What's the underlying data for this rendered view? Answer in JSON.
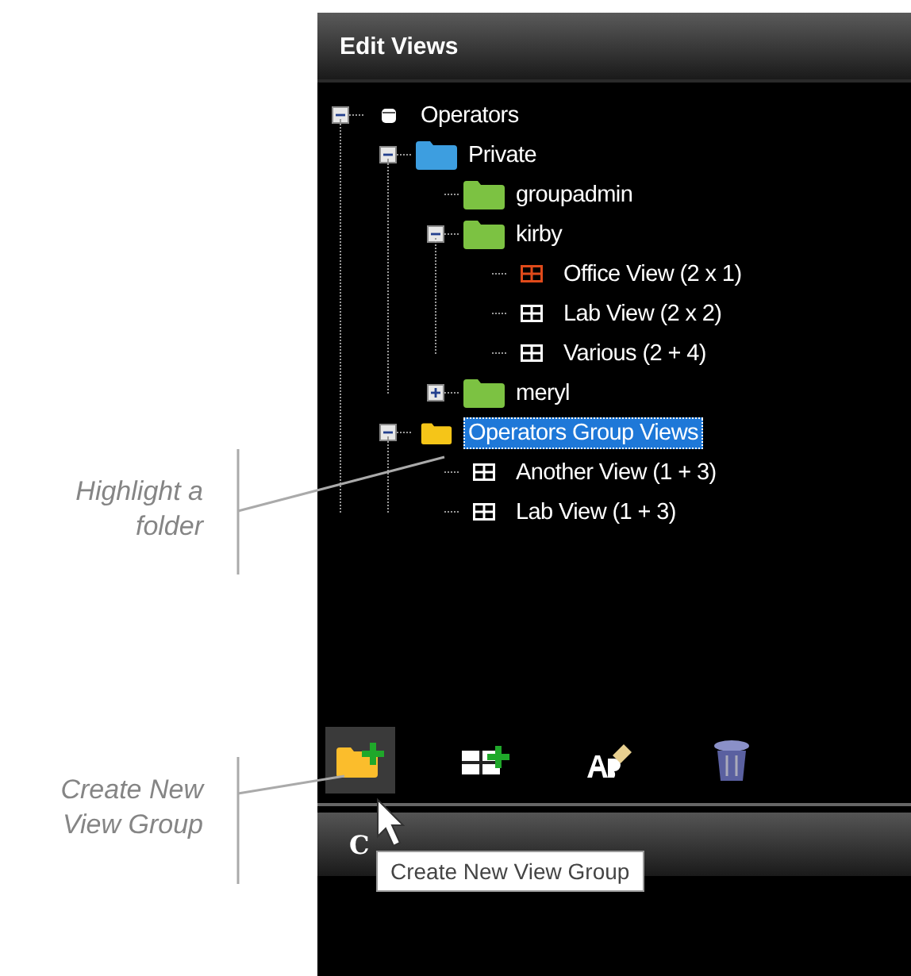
{
  "panel": {
    "title": "Edit Views"
  },
  "tree": [
    {
      "kind": "root",
      "label": "Operators",
      "expanded": true,
      "selected": false,
      "children": [
        {
          "kind": "folder",
          "label": "Private",
          "color": "#3d9ee0",
          "expanded": true,
          "selected": false,
          "children": [
            {
              "kind": "folder",
              "label": "groupadmin",
              "color": "#7cc242",
              "selected": false
            },
            {
              "kind": "folder",
              "label": "kirby",
              "color": "#7cc242",
              "expanded": true,
              "selected": false,
              "children": [
                {
                  "kind": "view",
                  "label": "Office View (2 x 1)",
                  "color": "#e04a1a",
                  "selected": false
                },
                {
                  "kind": "view",
                  "label": "Lab View (2 x 2)",
                  "color": "#ffffff",
                  "selected": false
                },
                {
                  "kind": "view",
                  "label": "Various (2 + 4)",
                  "color": "#ffffff",
                  "selected": false
                }
              ]
            },
            {
              "kind": "folder",
              "label": "meryl",
              "color": "#7cc242",
              "expanded": false,
              "selected": false
            }
          ]
        },
        {
          "kind": "folder",
          "label": "Operators Group Views",
          "color": "#f5c518",
          "expanded": true,
          "selected": true,
          "children": [
            {
              "kind": "view",
              "label": "Another View (1 + 3)",
              "color": "#ffffff",
              "selected": false
            },
            {
              "kind": "view",
              "label": "Lab View (1 + 3)",
              "color": "#ffffff",
              "selected": false
            }
          ]
        }
      ]
    }
  ],
  "toolbar": [
    {
      "kind": "new-group",
      "hovered": true
    },
    {
      "kind": "new-view",
      "hovered": false
    },
    {
      "kind": "rename",
      "hovered": false
    },
    {
      "kind": "delete",
      "hovered": false
    }
  ],
  "second_panel": {
    "title": "C"
  },
  "tooltip": "Create New View Group",
  "callouts": [
    {
      "text": "Highlight a folder"
    },
    {
      "text": "Create New View Group"
    }
  ]
}
